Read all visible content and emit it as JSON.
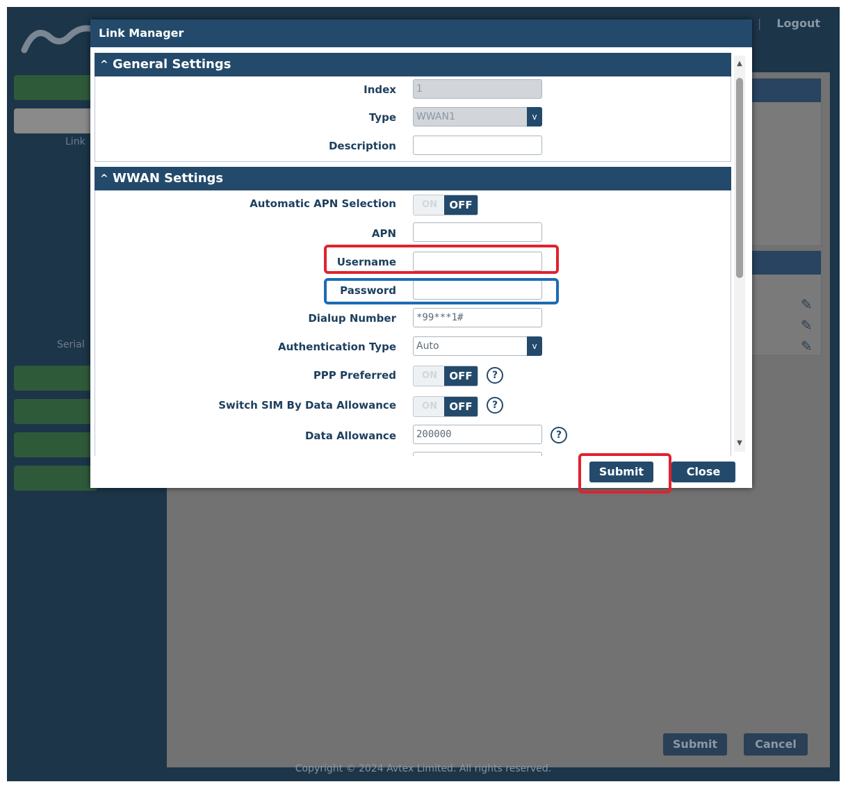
{
  "background": {
    "top_links": [
      "Logout"
    ],
    "side_labels": [
      "Link",
      "Serial"
    ],
    "buttons": {
      "submit": "Submit",
      "cancel": "Cancel"
    },
    "copyright": "Copyright © 2024 Avtex Limited. All rights reserved."
  },
  "modal": {
    "title": "Link Manager",
    "general": {
      "heading": "General Settings",
      "index_label": "Index",
      "index_value": "1",
      "type_label": "Type",
      "type_value": "WWAN1",
      "description_label": "Description",
      "description_value": ""
    },
    "wwan": {
      "heading": "WWAN Settings",
      "auto_apn_label": "Automatic APN Selection",
      "auto_apn_state": "OFF",
      "apn_label": "APN",
      "apn_value": "",
      "username_label": "Username",
      "username_value": "",
      "password_label": "Password",
      "password_value": "",
      "dialup_label": "Dialup Number",
      "dialup_value": "*99***1#",
      "auth_type_label": "Authentication Type",
      "auth_type_value": "Auto",
      "ppp_label": "PPP Preferred",
      "ppp_state": "OFF",
      "switch_sim_label": "Switch SIM By Data Allowance",
      "switch_sim_state": "OFF",
      "data_allowance_label": "Data Allowance",
      "data_allowance_value": "200000"
    },
    "toggle_on_text": "ON",
    "buttons": {
      "submit": "Submit",
      "close": "Close"
    }
  },
  "colors": {
    "header": "#234a6b",
    "highlight_red": "#e0222e",
    "highlight_blue": "#1c6bb5",
    "background_dark": "#1c3549"
  }
}
